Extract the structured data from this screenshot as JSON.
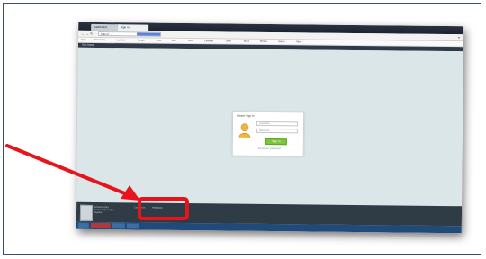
{
  "browser": {
    "tabs": [
      {
        "label": "Dashboard",
        "active": false
      },
      {
        "label": "Sign In",
        "active": true
      }
    ],
    "url": "https://...",
    "bookmarks": [
      "Apps",
      "Bookmarks",
      "Imported",
      "Google",
      "News",
      "Mail",
      "Docs",
      "Calendar",
      "Drive",
      "Maps",
      "Photos",
      "Videos",
      "Other"
    ]
  },
  "app": {
    "header_title": "SIS Portal",
    "login": {
      "title": "Please Sign In",
      "username_placeholder": "Username",
      "password_placeholder": "Password",
      "signin_label": "Sign In",
      "forgot_label": "Forgot your password?"
    },
    "footer": {
      "org_lines": [
        "School District",
        "Student Information",
        "System"
      ],
      "link_1": "Contact Us",
      "link_2": "Help Desk"
    }
  },
  "annotation": {
    "color": "#e8141b"
  },
  "colors": {
    "accent_green": "#7ec43d",
    "footer_bg": "#2f3b45",
    "content_bg": "#dbe6e8"
  }
}
